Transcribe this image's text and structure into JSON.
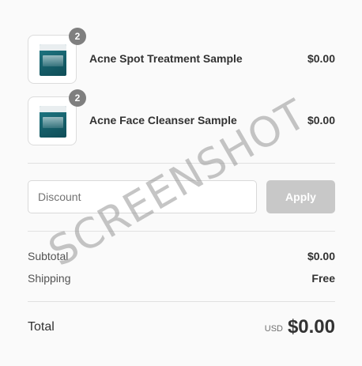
{
  "line_items": [
    {
      "name": "Acne Spot Treatment Sample",
      "price": "$0.00",
      "quantity": "2",
      "thumbnail": "product-packet-image"
    },
    {
      "name": "Acne Face Cleanser Sample",
      "price": "$0.00",
      "quantity": "2",
      "thumbnail": "product-packet-image"
    }
  ],
  "discount": {
    "placeholder": "Discount",
    "apply_label": "Apply"
  },
  "subtotal": {
    "label": "Subtotal",
    "value": "$0.00"
  },
  "shipping": {
    "label": "Shipping",
    "value": "Free"
  },
  "total": {
    "label": "Total",
    "currency": "USD",
    "amount": "$0.00"
  },
  "watermark": "SCREENSHOT",
  "colors": {
    "background": "#fafafa",
    "badge": "#7f7f7f",
    "apply_button_disabled": "#c8c8c8",
    "divider": "#e1e1e1",
    "packet_teal": "#16606b"
  }
}
